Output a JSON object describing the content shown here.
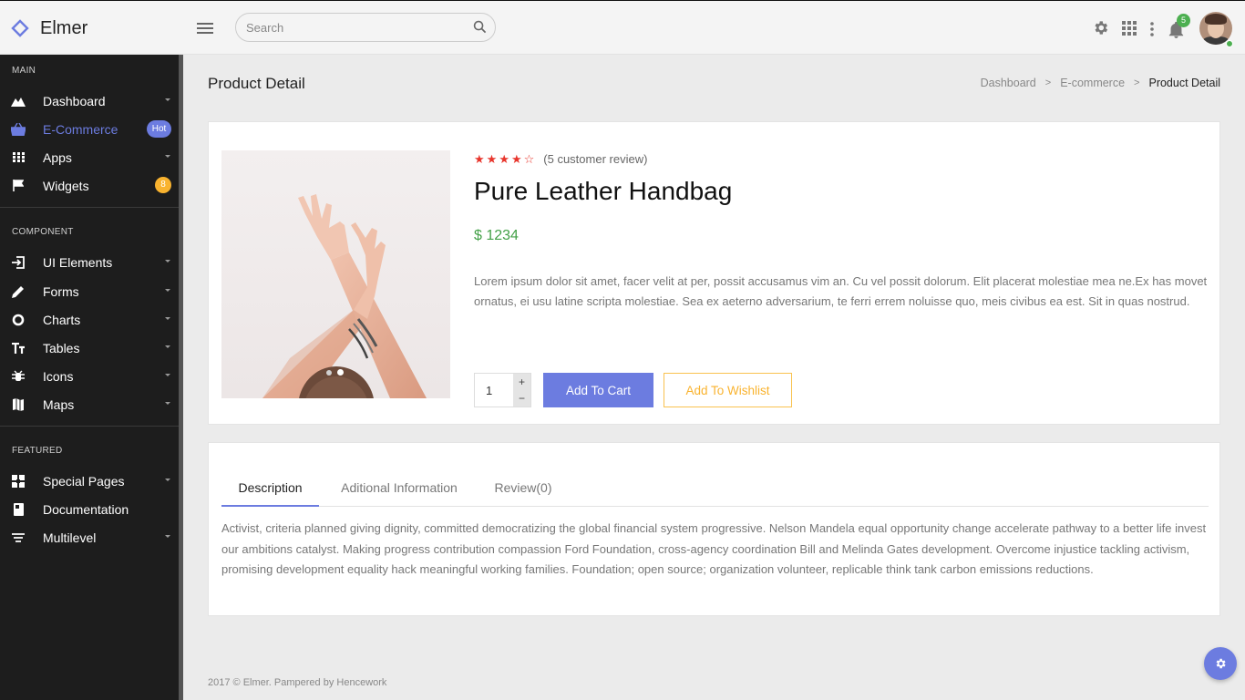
{
  "app": {
    "name": "Elmer"
  },
  "header": {
    "search_placeholder": "Search",
    "notification_count": "5"
  },
  "sidebar": {
    "sections": [
      {
        "title": "MAIN"
      },
      {
        "title": "COMPONENT"
      },
      {
        "title": "FEATURED"
      }
    ],
    "items": [
      {
        "label": "Dashboard",
        "icon": "chart-area-icon"
      },
      {
        "label": "E-Commerce",
        "icon": "basket-icon",
        "badge": "Hot",
        "active": true
      },
      {
        "label": "Apps",
        "icon": "apps-grid-icon"
      },
      {
        "label": "Widgets",
        "icon": "flag-icon",
        "badge": "8"
      },
      {
        "label": "UI Elements",
        "icon": "login-icon"
      },
      {
        "label": "Forms",
        "icon": "pencil-icon"
      },
      {
        "label": "Charts",
        "icon": "donut-icon"
      },
      {
        "label": "Tables",
        "icon": "format-size-icon"
      },
      {
        "label": "Icons",
        "icon": "bug-icon"
      },
      {
        "label": "Maps",
        "icon": "map-icon"
      },
      {
        "label": "Special Pages",
        "icon": "pages-icon"
      },
      {
        "label": "Documentation",
        "icon": "book-icon"
      },
      {
        "label": "Multilevel",
        "icon": "filter-list-icon"
      }
    ]
  },
  "page": {
    "title": "Product Detail",
    "breadcrumb": [
      "Dashboard",
      "E-commerce",
      "Product Detail"
    ]
  },
  "product": {
    "rating": 4,
    "rating_max": 5,
    "review_text": "(5 customer review)",
    "name": "Pure Leather Handbag",
    "price": "$ 1234",
    "description": "Lorem ipsum dolor sit amet, facer velit at per, possit accusamus vim an. Cu vel possit dolorum. Elit placerat molestiae mea ne.Ex has movet ornatus, ei usu latine scripta molestiae. Sea ex aeterno adversarium, te ferri errem noluisse quo, meis civibus ea est. Sit in quas nostrud.",
    "quantity": "1",
    "stepper_plus": "+",
    "stepper_minus": "−",
    "add_to_cart": "Add To Cart",
    "add_to_wishlist": "Add To Wishlist",
    "image_slides": 2,
    "active_slide": 2
  },
  "tabs": {
    "items": [
      "Description",
      "Aditional Information",
      "Review(0)"
    ],
    "active": 0,
    "content": "Activist, criteria planned giving dignity, committed democratizing the global financial system progressive. Nelson Mandela equal opportunity change accelerate pathway to a better life invest our ambitions catalyst. Making progress contribution compassion Ford Foundation, cross-agency coordination Bill and Melinda Gates development. Overcome injustice tackling activism, promising development equality hack meaningful working families. Foundation; open source; organization volunteer, replicable think tank carbon emissions reductions."
  },
  "footer": {
    "text": "2017 © Elmer. Pampered by Hencework"
  },
  "colors": {
    "accent": "#6c7ce0",
    "sidebar_bg": "#1d1d1d",
    "price": "#43a047",
    "star": "#e8352c",
    "warning": "#f9b32f",
    "success": "#4caf50"
  }
}
